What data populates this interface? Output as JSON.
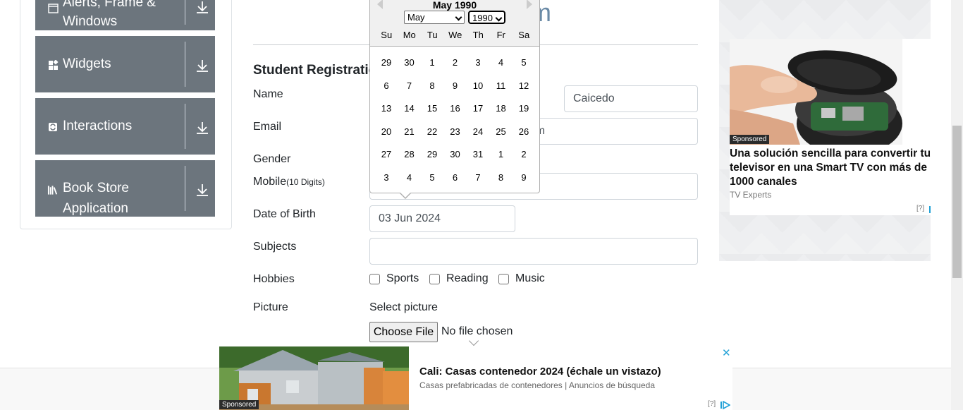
{
  "sidebar": {
    "groups": [
      {
        "label_lines": [
          "Alerts, Frame &",
          "Windows"
        ],
        "icon": "window-icon"
      },
      {
        "label_lines": [
          "Widgets"
        ],
        "icon": "widgets-icon"
      },
      {
        "label_lines": [
          "Interactions"
        ],
        "icon": "interactions-icon"
      },
      {
        "label_lines": [
          "Book Store",
          "Application"
        ],
        "icon": "book-icon"
      }
    ],
    "toggle_icon": "download-arrow-icon"
  },
  "page": {
    "title_fragment": "m",
    "form_title": "Student Registratio"
  },
  "form": {
    "name_label": "Name",
    "last_name_value": "Caicedo",
    "email_label": "Email",
    "email_value_fragment": "m",
    "gender_label": "Gender",
    "mobile_label": "Mobile",
    "mobile_hint": "(10 Digits)",
    "dob_label": "Date of Birth",
    "dob_value": "03 Jun 2024",
    "subjects_label": "Subjects",
    "subjects_value": "",
    "hobbies_label": "Hobbies",
    "hobbies": [
      "Sports",
      "Reading",
      "Music"
    ],
    "picture_label": "Picture",
    "select_picture": "Select picture",
    "choose_file": "Choose File",
    "no_file": "No file chosen"
  },
  "datepicker": {
    "current_month": "May 1990",
    "month_select": "May",
    "year_select": "1990",
    "weekdays": [
      "Su",
      "Mo",
      "Tu",
      "We",
      "Th",
      "Fr",
      "Sa"
    ],
    "weeks": [
      [
        "29",
        "30",
        "1",
        "2",
        "3",
        "4",
        "5"
      ],
      [
        "6",
        "7",
        "8",
        "9",
        "10",
        "11",
        "12"
      ],
      [
        "13",
        "14",
        "15",
        "16",
        "17",
        "18",
        "19"
      ],
      [
        "20",
        "21",
        "22",
        "23",
        "24",
        "25",
        "26"
      ],
      [
        "27",
        "28",
        "29",
        "30",
        "31",
        "1",
        "2"
      ],
      [
        "3",
        "4",
        "5",
        "6",
        "7",
        "8",
        "9"
      ]
    ]
  },
  "right_ad": {
    "badge": "Sponsored",
    "headline": "Una solución sencilla para convertir tu televisor en una Smart TV con más de 1000 canales",
    "brand": "TV Experts",
    "info": "[?]",
    "close": "✕",
    "accent_color": "#1fa0d6"
  },
  "bottom_ad": {
    "badge": "Sponsored",
    "headline": "Cali: Casas contenedor 2024 (échale un vistazo)",
    "sub": "Casas prefabricadas de contenedores | Anuncios de búsqueda",
    "info": "[?]",
    "close": "✕"
  },
  "colors": {
    "sidebar_group": "#6c757d",
    "ad_accent": "#1fa0d6"
  }
}
